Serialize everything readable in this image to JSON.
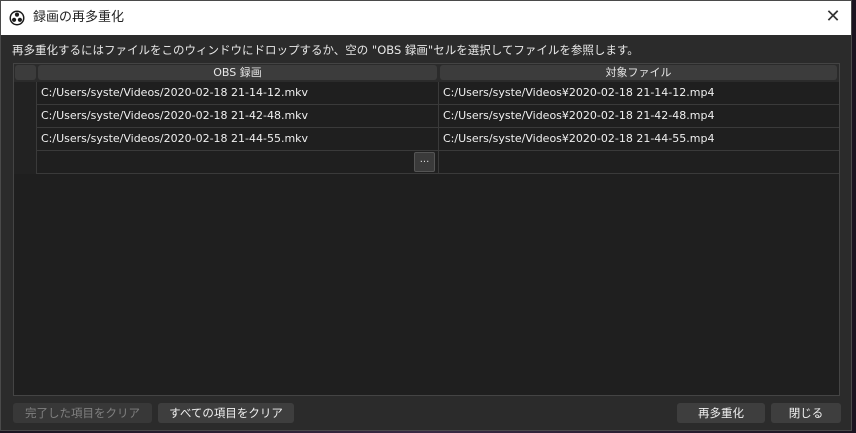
{
  "window": {
    "title": "録画の再多重化",
    "close_glyph": "✕"
  },
  "instructions": "再多重化するにはファイルをこのウィンドウにドロップするか、空の \"OBS 録画\"セルを選択してファイルを参照します。",
  "table": {
    "headers": [
      "OBS 録画",
      "対象ファイル"
    ],
    "rows": [
      {
        "source": "C:/Users/syste/Videos/2020-02-18 21-14-12.mkv",
        "target": "C:/Users/syste/Videos¥2020-02-18 21-14-12.mp4"
      },
      {
        "source": "C:/Users/syste/Videos/2020-02-18 21-42-48.mkv",
        "target": "C:/Users/syste/Videos¥2020-02-18 21-42-48.mp4"
      },
      {
        "source": "C:/Users/syste/Videos/2020-02-18 21-44-55.mkv",
        "target": "C:/Users/syste/Videos¥2020-02-18 21-44-55.mp4"
      },
      {
        "source": "",
        "target": ""
      }
    ],
    "browse_label": "..."
  },
  "buttons": {
    "clear_finished": "完了した項目をクリア",
    "clear_all": "すべての項目をクリア",
    "remux": "再多重化",
    "close": "閉じる"
  },
  "icons": {
    "app": "obs-logo-icon",
    "close": "close-icon",
    "browse": "ellipsis-icon"
  }
}
